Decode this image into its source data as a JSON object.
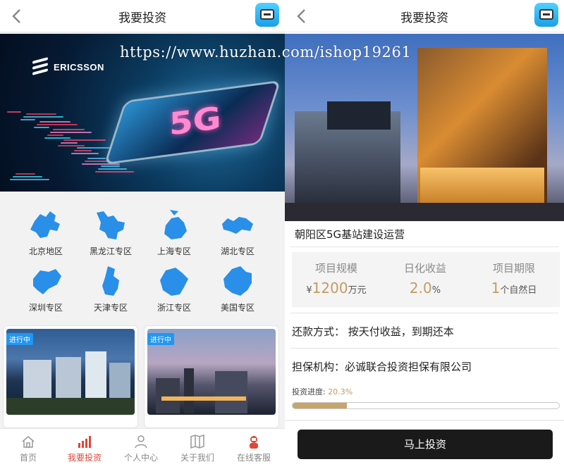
{
  "watermark": "https://www.huzhan.com/ishop19261",
  "left": {
    "nav": {
      "title": "我要投资"
    },
    "banner": {
      "brand": "ERICSSON",
      "badge": "5G"
    },
    "regions": [
      {
        "label": "北京地区",
        "icon": "beijing-map-icon"
      },
      {
        "label": "黑龙江专区",
        "icon": "heilongjiang-map-icon"
      },
      {
        "label": "上海专区",
        "icon": "shanghai-map-icon"
      },
      {
        "label": "湖北专区",
        "icon": "hubei-map-icon"
      },
      {
        "label": "深圳专区",
        "icon": "shenzhen-map-icon"
      },
      {
        "label": "天津专区",
        "icon": "tianjin-map-icon"
      },
      {
        "label": "浙江专区",
        "icon": "zhejiang-map-icon"
      },
      {
        "label": "美国专区",
        "icon": "usa-map-icon"
      }
    ],
    "cards": [
      {
        "tag": "进行中"
      },
      {
        "tag": "进行中"
      }
    ],
    "tabbar": [
      {
        "label": "首页",
        "icon": "home-icon",
        "active": false
      },
      {
        "label": "我要投资",
        "icon": "bar-chart-icon",
        "active": true
      },
      {
        "label": "个人中心",
        "icon": "person-icon",
        "active": false
      },
      {
        "label": "关于我们",
        "icon": "map-book-icon",
        "active": false
      },
      {
        "label": "在线客服",
        "icon": "support-agent-icon",
        "active": false
      }
    ]
  },
  "right": {
    "nav": {
      "title": "我要投资"
    },
    "project": {
      "title": "朝阳区5G基站建设运营",
      "scale_label": "项目规模",
      "scale_prefix": "¥",
      "scale_value": "1200",
      "scale_unit": "万元",
      "yield_label": "日化收益",
      "yield_value": "2.0",
      "yield_unit": "%",
      "term_label": "项目期限",
      "term_value": "1",
      "term_unit": "个自然日",
      "repay": "还款方式： 按天付收益，到期还本",
      "guarantor": "担保机构：必诚联合投资担保有限公司",
      "progress_label": "投资进度:",
      "progress_text": "20.3%",
      "progress_percent": 20.3
    },
    "button": "马上投资"
  },
  "colors": {
    "accent": "#c39b61",
    "active_tab": "#e0463a",
    "map_blue": "#2a8fe8",
    "button_bg": "#1a1a1a"
  }
}
